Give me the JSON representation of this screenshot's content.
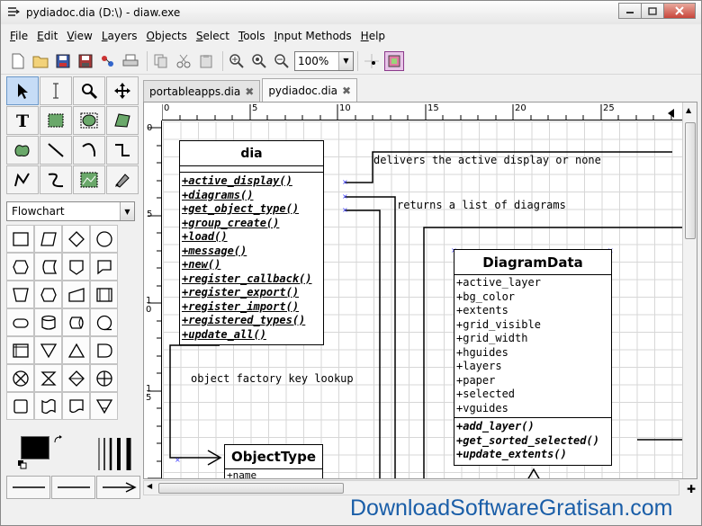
{
  "window": {
    "title": "pydiadoc.dia (D:\\) - diaw.exe",
    "minimize": "▭",
    "maximize": "□",
    "close": "✕"
  },
  "menu": [
    {
      "label": "File",
      "key": "F",
      "rest": "ile"
    },
    {
      "label": "Edit",
      "key": "E",
      "rest": "dit"
    },
    {
      "label": "View",
      "key": "V",
      "rest": "iew"
    },
    {
      "label": "Layers",
      "key": "L",
      "rest": "ayers"
    },
    {
      "label": "Objects",
      "key": "O",
      "rest": "bjects"
    },
    {
      "label": "Select",
      "key": "S",
      "rest": "elect"
    },
    {
      "label": "Tools",
      "key": "T",
      "rest": "ools"
    },
    {
      "label": "Input Methods",
      "key": "I",
      "rest": "nput Methods"
    },
    {
      "label": "Help",
      "key": "H",
      "rest": "elp"
    }
  ],
  "toolbar": {
    "zoom": "100%"
  },
  "toolbox": {
    "sheet": "Flowchart"
  },
  "tabs": [
    {
      "label": "portableapps.dia",
      "active": false
    },
    {
      "label": "pydiadoc.dia",
      "active": true
    }
  ],
  "rulers": {
    "h": [
      "0",
      "5",
      "10",
      "15",
      "20",
      "25"
    ],
    "v": [
      "0",
      "5",
      "10",
      "15"
    ]
  },
  "diagram": {
    "dia_class": {
      "name": "dia",
      "operations": [
        "+active_display()",
        "+diagrams()",
        "+get_object_type()",
        "+group_create()",
        "+load()",
        "+message()",
        "+new()",
        "+register_callback()",
        "+register_export()",
        "+register_import()",
        "+registered_types()",
        "+update_all()"
      ]
    },
    "diagramdata_class": {
      "name": "DiagramData",
      "attributes": [
        "+active_layer",
        "+bg_color",
        "+extents",
        "+grid_visible",
        "+grid_width",
        "+hguides",
        "+layers",
        "+paper",
        "+selected",
        "+vguides"
      ],
      "operations": [
        "+add_layer()",
        "+get_sorted_selected()",
        "+update_extents()"
      ]
    },
    "objecttype_class": {
      "name": "ObjectType",
      "attributes": [
        "+name"
      ]
    },
    "labels": {
      "active_display": "delivers the active display or none",
      "diagrams": "returns a list of diagrams",
      "factory": "object factory key lookup"
    }
  },
  "watermark": "DownloadSoftwareGratisan.com"
}
